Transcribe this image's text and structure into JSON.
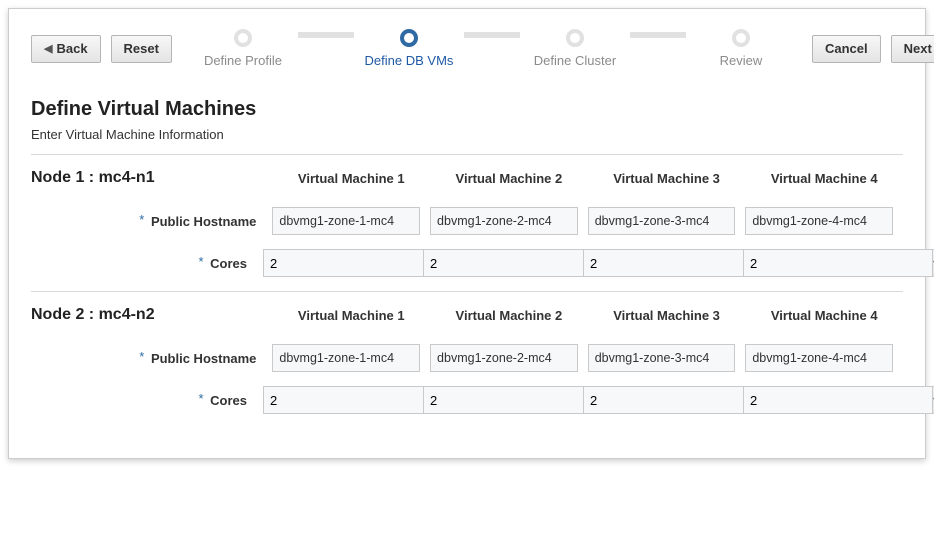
{
  "toolbar": {
    "back_label": "Back",
    "reset_label": "Reset",
    "cancel_label": "Cancel",
    "next_label": "Next"
  },
  "wizard": {
    "steps": [
      {
        "label": "Define Profile",
        "active": false
      },
      {
        "label": "Define DB VMs",
        "active": true
      },
      {
        "label": "Define Cluster",
        "active": false
      },
      {
        "label": "Review",
        "active": false
      }
    ]
  },
  "page": {
    "title": "Define Virtual Machines",
    "subtitle": "Enter Virtual Machine Information"
  },
  "fields": {
    "public_hostname_label": "Public Hostname",
    "cores_label": "Cores"
  },
  "vm_headers": [
    "Virtual Machine 1",
    "Virtual Machine 2",
    "Virtual Machine 3",
    "Virtual Machine 4"
  ],
  "nodes": [
    {
      "title": "Node 1 : mc4-n1",
      "vms": [
        {
          "hostname": "dbvmg1-zone-1-mc4",
          "cores": "2"
        },
        {
          "hostname": "dbvmg1-zone-2-mc4",
          "cores": "2"
        },
        {
          "hostname": "dbvmg1-zone-3-mc4",
          "cores": "2"
        },
        {
          "hostname": "dbvmg1-zone-4-mc4",
          "cores": "2"
        }
      ]
    },
    {
      "title": "Node 2 : mc4-n2",
      "vms": [
        {
          "hostname": "dbvmg1-zone-1-mc4",
          "cores": "2"
        },
        {
          "hostname": "dbvmg1-zone-2-mc4",
          "cores": "2"
        },
        {
          "hostname": "dbvmg1-zone-3-mc4",
          "cores": "2"
        },
        {
          "hostname": "dbvmg1-zone-4-mc4",
          "cores": "2"
        }
      ]
    }
  ]
}
